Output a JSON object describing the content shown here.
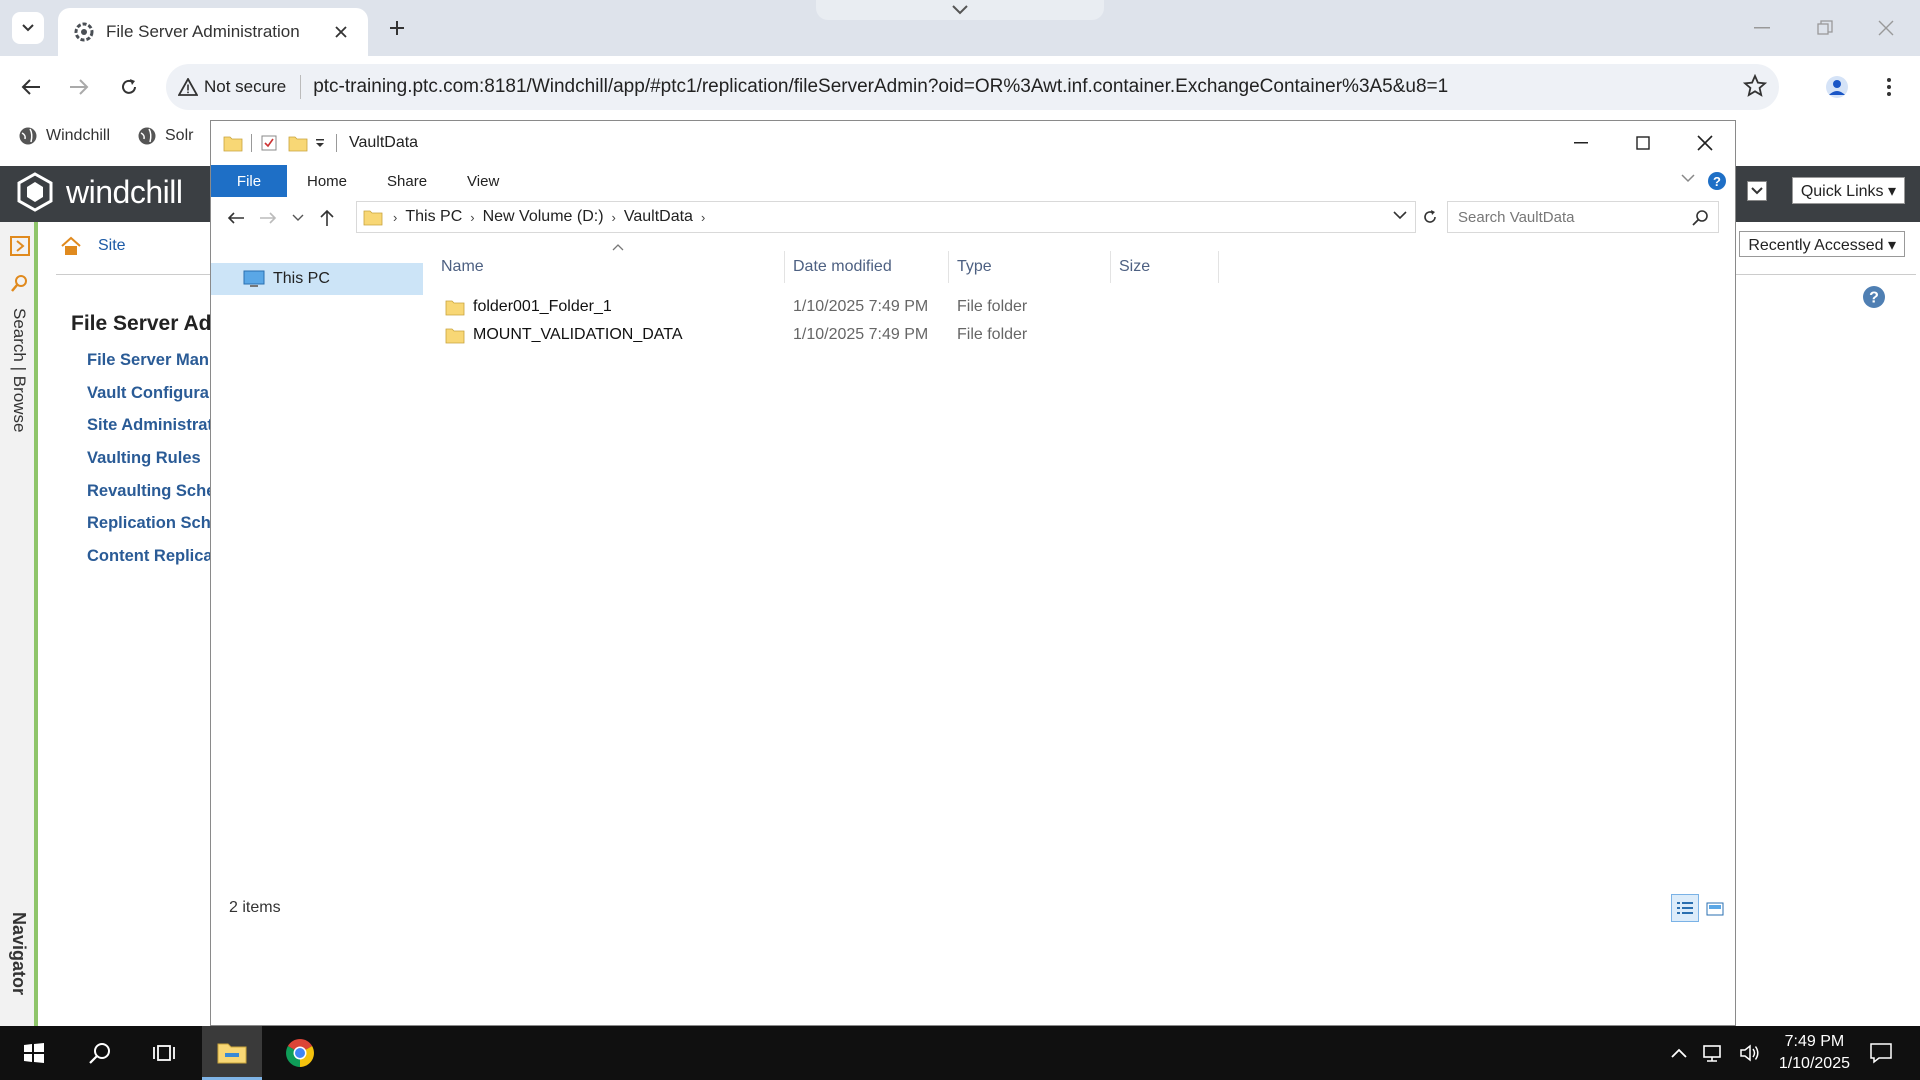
{
  "browser": {
    "tab_title": "File Server Administration",
    "security_label": "Not secure",
    "url": "ptc-training.ptc.com:8181/Windchill/app/#ptc1/replication/fileServerAdmin?oid=OR%3Awt.inf.container.ExchangeContainer%3A5&u8=1",
    "bookmarks": [
      "Windchill",
      "Solr"
    ]
  },
  "windchill": {
    "logo_text": "windchill",
    "quick_links": "Quick Links ▾",
    "recently_accessed": "Recently Accessed ▾",
    "breadcrumb": "Site",
    "page_title": "File Server Ad",
    "left_tabs": {
      "search_browse": "Search | Browse",
      "navigator": "Navigator"
    },
    "links": [
      "File Server Man:",
      "Vault Configura",
      "Site Administrat",
      "Vaulting Rules",
      "Revaulting Sche",
      "Replication Sche",
      "Content Replica"
    ]
  },
  "explorer": {
    "title": "VaultData",
    "ribbon_tabs": [
      "File",
      "Home",
      "Share",
      "View"
    ],
    "path": [
      "This PC",
      "New Volume (D:)",
      "VaultData"
    ],
    "search_placeholder": "Search VaultData",
    "nav_pane": {
      "this_pc": "This PC"
    },
    "columns": {
      "name": "Name",
      "date": "Date modified",
      "type": "Type",
      "size": "Size"
    },
    "files": [
      {
        "name": "folder001_Folder_1",
        "date": "1/10/2025 7:49 PM",
        "type": "File folder",
        "size": ""
      },
      {
        "name": "MOUNT_VALIDATION_DATA",
        "date": "1/10/2025 7:49 PM",
        "type": "File folder",
        "size": ""
      }
    ],
    "status": "2 items"
  },
  "taskbar": {
    "time": "7:49 PM",
    "date": "1/10/2025"
  },
  "colors": {
    "ribbon_file_tab": "#1e6fc6",
    "windchill_header": "#3b3f43",
    "link_blue": "#2a5b96",
    "folder_yellow": "#f8d775",
    "nav_selected": "#cce4f7"
  }
}
